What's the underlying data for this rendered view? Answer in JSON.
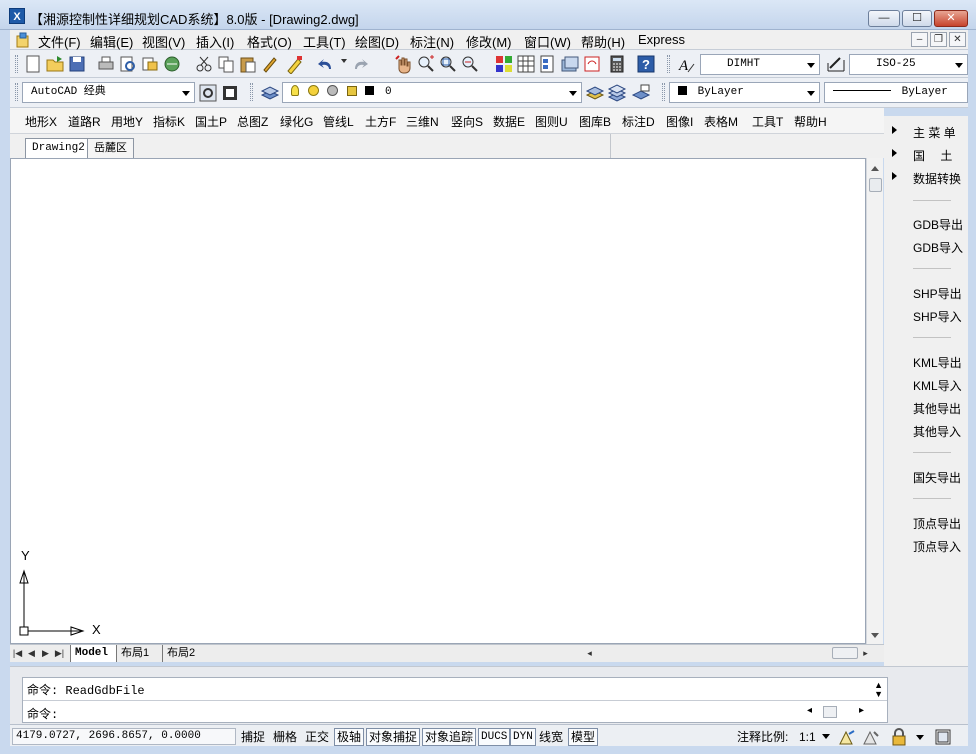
{
  "window": {
    "title": "【湘源控制性详细规划CAD系统】8.0版 - [Drawing2.dwg]",
    "app_icon_glyph": "X",
    "minimize_glyph": "—",
    "maximize_glyph": "☐",
    "close_glyph": "✕"
  },
  "menubar": {
    "items": [
      "文件(F)",
      "编辑(E)",
      "视图(V)",
      "插入(I)",
      "格式(O)",
      "工具(T)",
      "绘图(D)",
      "标注(N)",
      "修改(M)",
      "窗口(W)",
      "帮助(H)",
      "Express"
    ],
    "mdi_minimize": "–",
    "mdi_restore": "❐",
    "mdi_close": "✕"
  },
  "toolbar1": {
    "dimstyle": "DIMHT",
    "textstyle": "ISO-25",
    "icons": [
      "new-icon",
      "open-icon",
      "save-icon",
      "print-icon",
      "plot-preview-icon",
      "publish-icon",
      "3d-icon",
      "cut-icon",
      "copy-icon",
      "paste-icon",
      "match-properties-icon",
      "block-editor-icon",
      "undo-icon",
      "redo-icon",
      "pan-icon",
      "zoom-realtime-icon",
      "zoom-window-icon",
      "zoom-previous-icon",
      "properties-icon",
      "design-center-icon",
      "tool-palettes-icon",
      "sheet-set-icon",
      "markup-icon",
      "calculator-icon",
      "help-icon",
      "text-style-icon",
      "dim-style-icon"
    ]
  },
  "toolbar2": {
    "workspace": "AutoCAD 经典",
    "layer_name": "0",
    "color": "ByLayer",
    "linetype": "ByLayer"
  },
  "custom_menu": {
    "items": [
      "地形X",
      "道路R",
      "用地Y",
      "指标K",
      "国土P",
      "总图Z",
      "绿化G",
      "管线L",
      "土方F",
      "三维N",
      "竖向S",
      "数据E",
      "图则U",
      "图库B",
      "标注D",
      "图像I",
      "表格M",
      "工具T",
      "帮助H"
    ]
  },
  "doc_tabs": [
    "Drawing2",
    "岳麓区"
  ],
  "canvas": {
    "ucs_x": "X",
    "ucs_y": "Y"
  },
  "layout_tabs": [
    "Model",
    "布局1",
    "布局2"
  ],
  "side_panel": {
    "menus": [
      "主 菜 单",
      "国　 土",
      "数据转换"
    ],
    "items": [
      "GDB导出",
      "GDB导入",
      "SHP导出",
      "SHP导入",
      "KML导出",
      "KML导入",
      "其他导出",
      "其他导入",
      "国矢导出",
      "顶点导出",
      "顶点导入"
    ]
  },
  "command": {
    "history": "命令: ReadGdbFile",
    "prompt": "命令:"
  },
  "statusbar": {
    "coords": "4179.0727, 2696.8657, 0.0000",
    "toggles": [
      "捕捉",
      "栅格",
      "正交",
      "极轴",
      "对象捕捉",
      "对象追踪",
      "DUCS",
      "DYN",
      "线宽",
      "模型"
    ],
    "anno_label": "注释比例:",
    "anno_scale": "1:1"
  },
  "colors": {
    "titlebar": "#c4d5ec",
    "chrome": "#edf0f5",
    "canvas": "#ffffff"
  }
}
